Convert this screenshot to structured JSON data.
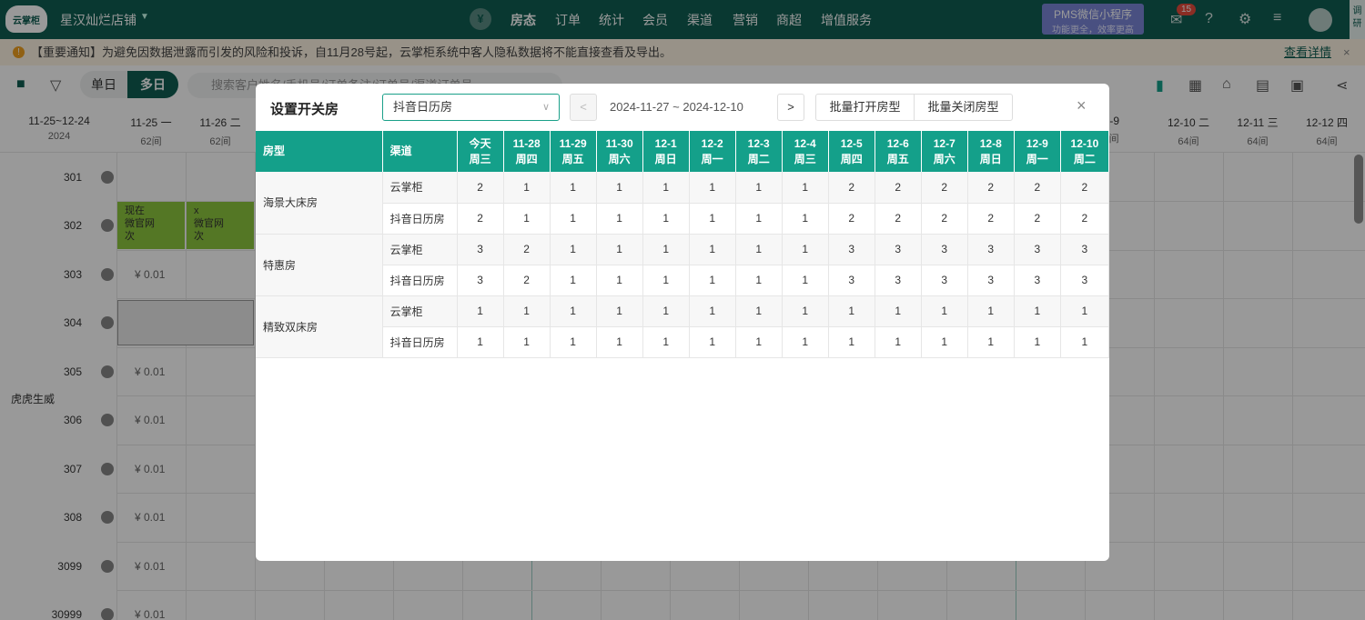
{
  "topnav": {
    "logo": "云掌柜",
    "store": "星汉灿烂店铺",
    "nav": [
      "房态",
      "订单",
      "统计",
      "会员",
      "渠道",
      "营销",
      "商超",
      "增值服务"
    ],
    "pms_line1": "PMS微信小程序",
    "pms_line2": "功能更全，效率更高",
    "badge": "15",
    "side_tab": "调研"
  },
  "notice": {
    "text": "【重要通知】为避免因数据泄露而引发的风险和投诉，自11月28号起，云掌柜系统中客人隐私数据将不能直接查看及导出。",
    "link": "查看详情"
  },
  "toolbar": {
    "single": "单日",
    "multi": "多日",
    "search_placeholder": "搜索客户姓名/手机号/订单备注/订单号/渠道订单号"
  },
  "calendar": {
    "range": "11-25~12-24",
    "year": "2024",
    "dates_left": [
      {
        "d": "11-25",
        "w": "一",
        "n": "62间"
      },
      {
        "d": "11-26",
        "w": "二",
        "n": "62间"
      }
    ],
    "dates_right": [
      {
        "d": "12-9",
        "w": "",
        "n": "64间"
      },
      {
        "d": "12-10",
        "w": "二",
        "n": "64间"
      },
      {
        "d": "12-11",
        "w": "三",
        "n": "64间"
      },
      {
        "d": "12-12",
        "w": "四",
        "n": "64间"
      }
    ],
    "rooms": [
      "301",
      "302",
      "303",
      "304",
      "305",
      "306",
      "307",
      "308",
      "3099",
      "30999"
    ],
    "price": "¥ 0.01",
    "group": "虎虎生威",
    "bookings": [
      {
        "l1": "现在",
        "l2": "微官网",
        "tag": "次"
      },
      {
        "l1": "x",
        "l2": "微官网",
        "tag": "次"
      }
    ]
  },
  "modal": {
    "title": "设置开关房",
    "select_value": "抖音日历房",
    "range": "2024-11-27 ~ 2024-12-10",
    "btn_open": "批量打开房型",
    "btn_close": "批量关闭房型",
    "close": "×",
    "table": {
      "col_room": "房型",
      "col_channel": "渠道",
      "days": [
        {
          "d": "今天",
          "w": "周三"
        },
        {
          "d": "11-28",
          "w": "周四"
        },
        {
          "d": "11-29",
          "w": "周五"
        },
        {
          "d": "11-30",
          "w": "周六"
        },
        {
          "d": "12-1",
          "w": "周日"
        },
        {
          "d": "12-2",
          "w": "周一"
        },
        {
          "d": "12-3",
          "w": "周二"
        },
        {
          "d": "12-4",
          "w": "周三"
        },
        {
          "d": "12-5",
          "w": "周四"
        },
        {
          "d": "12-6",
          "w": "周五"
        },
        {
          "d": "12-7",
          "w": "周六"
        },
        {
          "d": "12-8",
          "w": "周日"
        },
        {
          "d": "12-9",
          "w": "周一"
        },
        {
          "d": "12-10",
          "w": "周二"
        }
      ],
      "groups": [
        {
          "name": "海景大床房",
          "rows": [
            {
              "channel": "云掌柜",
              "values": [
                "2",
                "1",
                "1",
                "1",
                "1",
                "1",
                "1",
                "1",
                "2",
                "2",
                "2",
                "2",
                "2",
                "2"
              ]
            },
            {
              "channel": "抖音日历房",
              "values": [
                "2",
                "1",
                "1",
                "1",
                "1",
                "1",
                "1",
                "1",
                "2",
                "2",
                "2",
                "2",
                "2",
                "2"
              ]
            }
          ]
        },
        {
          "name": "特惠房",
          "rows": [
            {
              "channel": "云掌柜",
              "values": [
                "3",
                "2",
                "1",
                "1",
                "1",
                "1",
                "1",
                "1",
                "3",
                "3",
                "3",
                "3",
                "3",
                "3"
              ]
            },
            {
              "channel": "抖音日历房",
              "values": [
                "3",
                "2",
                "1",
                "1",
                "1",
                "1",
                "1",
                "1",
                "3",
                "3",
                "3",
                "3",
                "3",
                "3"
              ]
            }
          ]
        },
        {
          "name": "精致双床房",
          "rows": [
            {
              "channel": "云掌柜",
              "values": [
                "1",
                "1",
                "1",
                "1",
                "1",
                "1",
                "1",
                "1",
                "1",
                "1",
                "1",
                "1",
                "1",
                "1"
              ]
            },
            {
              "channel": "抖音日历房",
              "values": [
                "1",
                "1",
                "1",
                "1",
                "1",
                "1",
                "1",
                "1",
                "1",
                "1",
                "1",
                "1",
                "1",
                "1"
              ]
            }
          ]
        }
      ]
    }
  }
}
